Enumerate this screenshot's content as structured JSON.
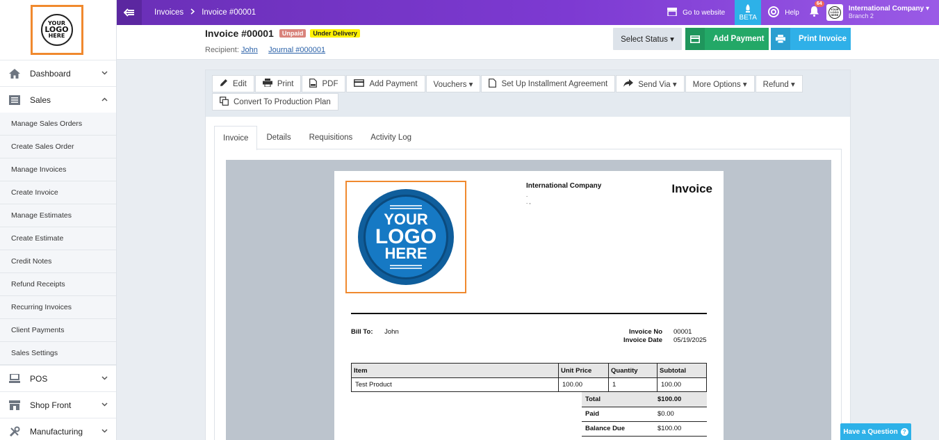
{
  "sidebar": {
    "logo": {
      "line1": "YOUR",
      "line2": "LOGO",
      "line3": "HERE"
    },
    "dashboard": "Dashboard",
    "sales": "Sales",
    "sales_items": [
      "Manage Sales Orders",
      "Create Sales Order",
      "Manage Invoices",
      "Create Invoice",
      "Manage Estimates",
      "Create Estimate",
      "Credit Notes",
      "Refund Receipts",
      "Recurring Invoices",
      "Client Payments",
      "Sales Settings"
    ],
    "pos": "POS",
    "shop_front": "Shop Front",
    "manufacturing": "Manufacturing"
  },
  "topbar": {
    "crumb1": "Invoices",
    "crumb2": "Invoice #00001",
    "go_website": "Go to website",
    "beta": "BETA",
    "help": "Help",
    "notif_count": "64",
    "company": "International Company",
    "branch": "Branch 2",
    "avatar_text": "YOUR LOGO HERE"
  },
  "header": {
    "title": "Invoice #00001",
    "tag_unpaid": "Unpaid",
    "tag_delivery": "Under Delivery",
    "recipient_label": "Recipient:",
    "recipient": "John",
    "journal": "Journal #000001",
    "select_status": "Select Status ▾",
    "add_payment": "Add Payment",
    "print_invoice": "Print Invoice"
  },
  "toolbar": {
    "edit": "Edit",
    "print": "Print",
    "pdf": "PDF",
    "add_payment": "Add Payment",
    "vouchers": "Vouchers ▾",
    "installment": "Set Up Installment Agreement",
    "send_via": "Send Via ▾",
    "more_options": "More Options ▾",
    "refund": "Refund ▾",
    "convert": "Convert To Production Plan"
  },
  "tabs": [
    "Invoice",
    "Details",
    "Requisitions",
    "Activity Log"
  ],
  "invoice": {
    "logo": {
      "line1": "YOUR",
      "line2": "LOGO",
      "line3": "HERE"
    },
    "company": "International Company",
    "company_line1": ".",
    "company_line2": ". ,",
    "title": "Invoice",
    "bill_to_label": "Bill To:",
    "bill_to": "John",
    "invoice_no_label": "Invoice No",
    "invoice_no": "00001",
    "invoice_date_label": "Invoice Date",
    "invoice_date": "05/19/2025",
    "columns": [
      "Item",
      "Unit Price",
      "Quantity",
      "Subtotal"
    ],
    "rows": [
      [
        "Test Product",
        "100.00",
        "1",
        "100.00"
      ]
    ],
    "total_label": "Total",
    "total": "$100.00",
    "paid_label": "Paid",
    "paid": "$0.00",
    "balance_label": "Balance Due",
    "balance": "$100.00"
  },
  "question": "Have a Question",
  "colors": {
    "purple": "#7d3ad2",
    "green": "#23a867",
    "blue": "#2fb0e8",
    "orange": "#f0892e"
  }
}
